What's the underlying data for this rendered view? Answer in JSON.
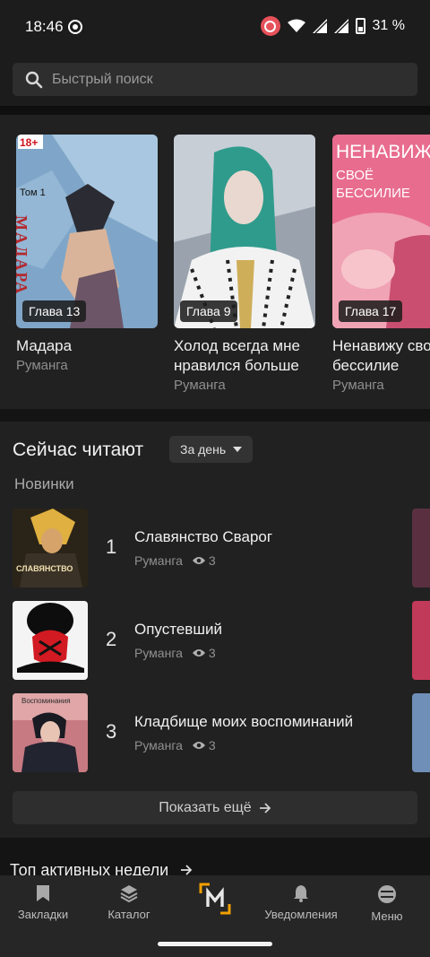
{
  "status_bar": {
    "time": "18:46",
    "battery": "31 %"
  },
  "search": {
    "placeholder": "Быстрый поиск"
  },
  "carousel": [
    {
      "chapter": "Глава 13",
      "title": "Мадара",
      "source": "Руманга",
      "cover_badge": "18+",
      "cover_text_1": "Том 1",
      "cover_text_2": "МАДАРА"
    },
    {
      "chapter": "Глава 9",
      "title": "Холод всегда мне нравился больше",
      "source": "Руманга"
    },
    {
      "chapter": "Глава 17",
      "title": "Ненавижу своё бессилие",
      "source": "Руманга",
      "cover_text_1": "НЕНАВИЖУ",
      "cover_text_2": "СВОЁ",
      "cover_text_3": "БЕССИЛИЕ"
    }
  ],
  "reading": {
    "title": "Сейчас читают",
    "period": "За день",
    "subtitle": "Новинки",
    "items": [
      {
        "rank": "1",
        "title": "Славянство Сварог",
        "source": "Руманга",
        "views": "3",
        "cover_text": "СЛАВЯНСТВО"
      },
      {
        "rank": "2",
        "title": "Опустевший",
        "source": "Руманга",
        "views": "3"
      },
      {
        "rank": "3",
        "title": "Кладбище моих воспоминаний",
        "source": "Руманга",
        "views": "3",
        "cover_text": "Воспоминания"
      }
    ],
    "show_more": "Показать ещё"
  },
  "top_active": {
    "title": "Топ активных недели"
  },
  "bottom_nav": [
    {
      "label": "Закладки",
      "icon": "bookmark-icon"
    },
    {
      "label": "Каталог",
      "icon": "layers-icon"
    },
    {
      "label": "",
      "icon": "logo-m-icon"
    },
    {
      "label": "Уведомления",
      "icon": "bell-icon"
    },
    {
      "label": "Меню",
      "icon": "menu-icon"
    }
  ],
  "colors": {
    "background": "#1b1b1b",
    "panel": "#212121",
    "accent": "#f2a000"
  }
}
